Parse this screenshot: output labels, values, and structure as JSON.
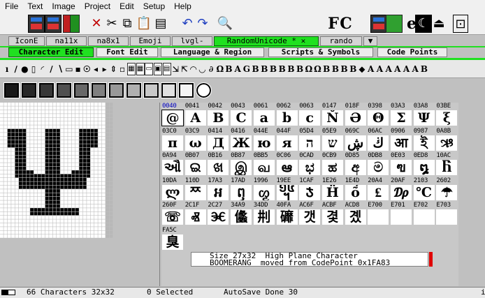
{
  "menubar": [
    "File",
    "Text",
    "Image",
    "Project",
    "Edit",
    "Setup",
    "Help"
  ],
  "toolbar1": {
    "icons": [
      "new-app-icon",
      "save-app-icon",
      "book-red-icon",
      "book-green-icon",
      "delete-x-icon",
      "cut-icon",
      "copy-icon",
      "paste-icon",
      "clipboard-icon",
      "undo-icon",
      "redo-icon",
      "zoom-icon",
      "text-icon",
      "font-family-icon",
      "font-code-icon",
      "app-blue-icon",
      "app-green-icon",
      "multi-app-icon",
      "glyph-icon",
      "crescent-icon",
      "figure-icon",
      "fit-window-icon"
    ],
    "text_f": "F",
    "text_c": "C",
    "text_e": "e"
  },
  "tabs1": [
    {
      "label": "IconE",
      "active": false
    },
    {
      "label": "na11x",
      "active": false
    },
    {
      "label": "na8x1",
      "active": false
    },
    {
      "label": "Emoji",
      "active": false
    },
    {
      "label": "lvgl-",
      "active": false
    },
    {
      "label": "RandomUnicode * ✕",
      "active": true
    },
    {
      "label": "rando",
      "active": false
    },
    {
      "label": "▼",
      "active": false
    }
  ],
  "tabs2": [
    {
      "label": "Character Edit",
      "active": true
    },
    {
      "label": "Font Edit",
      "active": false
    },
    {
      "label": "Language & Region",
      "active": false
    },
    {
      "label": "Scripts & Symbols",
      "active": false
    },
    {
      "label": "Code Points",
      "active": false
    }
  ],
  "toolbar2_glyphs": [
    "ı",
    "∕",
    "●",
    "▯",
    "◜",
    "∕",
    "∖",
    "▭",
    "▪",
    "☉",
    "◂",
    "▸",
    "⇕",
    "▫",
    "▦",
    "▦",
    "▭",
    "▣",
    "▤",
    "⇲",
    "⇱",
    "◠",
    "◡",
    "∂",
    "Ω",
    "B",
    "A",
    "G",
    "B",
    "B",
    "B",
    "B",
    "B",
    "B",
    "Ω",
    "Ω",
    "B",
    "B",
    "B",
    "B",
    "⬥",
    "A",
    "A",
    "A",
    "A",
    "A",
    "A",
    "B"
  ],
  "shades": [
    "#181818",
    "#282828",
    "#383838",
    "#505050",
    "#686868",
    "#808080",
    "#989898",
    "#b0b0b0",
    "#c8c8c8",
    "#e0e0e0",
    "#f4f4f4",
    "circle"
  ],
  "charmap": {
    "rows": [
      {
        "codes": [
          "0040",
          "0041",
          "0042",
          "0043",
          "0061",
          "0062",
          "0063",
          "0147",
          "018F",
          "0398",
          "03A3",
          "03A8",
          "03BE"
        ],
        "glyphs": [
          "@",
          "A",
          "B",
          "C",
          "a",
          "b",
          "c",
          "Ň",
          "Ə",
          "Θ",
          "Σ",
          "Ψ",
          "ξ"
        ]
      },
      {
        "codes": [
          "03C0",
          "03C9",
          "0414",
          "0416",
          "044E",
          "044F",
          "05D4",
          "05E9",
          "069C",
          "06AC",
          "0906",
          "0987",
          "0A8B"
        ],
        "glyphs": [
          "π",
          "ω",
          "Д",
          "Ж",
          "ю",
          "я",
          "ה",
          "ש",
          "ڜ",
          "ڬ",
          "आ",
          "ই",
          "ઋ"
        ]
      },
      {
        "codes": [
          "0A94",
          "0B07",
          "0B16",
          "0B87",
          "0BB5",
          "0C06",
          "0CAD",
          "0CB9",
          "0D85",
          "0DB8",
          "0E03",
          "0ED8",
          "10AC"
        ],
        "glyphs": [
          "ઔ",
          "ଇ",
          "ଖ",
          "இ",
          "வ",
          "ఆ",
          "ಭ",
          "ಹ",
          "අ",
          "ම",
          "ฃ",
          "໘",
          "Ⴌ"
        ]
      },
      {
        "codes": [
          "10DA",
          "110D",
          "17A3",
          "17AD",
          "1996",
          "19EE",
          "1CAF",
          "1E26",
          "1E4D",
          "20A4",
          "20AF",
          "2103",
          "2602"
        ],
        "glyphs": [
          "ლ",
          "ᄍ",
          "ឣ",
          "ឭ",
          "ᦖ",
          "᧮",
          "Ჯ",
          "Ḧ",
          "ṍ",
          "₤",
          "₯",
          "℃",
          "☂"
        ]
      },
      {
        "codes": [
          "260F",
          "2C1F",
          "2C27",
          "34A9",
          "34DD",
          "40FA",
          "AC6F",
          "ACBF",
          "ACD8",
          "E700",
          "E701",
          "E702",
          "E703"
        ],
        "glyphs": [
          "☏",
          "Ⱏ",
          "Ⱗ",
          "㒩",
          "㓝",
          "䃺",
          "갯",
          "겿",
          "곘",
          "",
          "",
          "",
          ""
        ]
      },
      {
        "codes": [
          "FA5C"
        ],
        "glyphs": [
          "臭"
        ]
      }
    ],
    "selected_code": "0040"
  },
  "info": {
    "line1": "Size 27x32  High Plane Character",
    "line2": "BOOMERANG  moved from CodePoint 0x1FA83"
  },
  "status": {
    "count": "66 Characters 32x32",
    "selected": "0 Selected",
    "autosave": "AutoSave Done 30",
    "end": "i"
  }
}
